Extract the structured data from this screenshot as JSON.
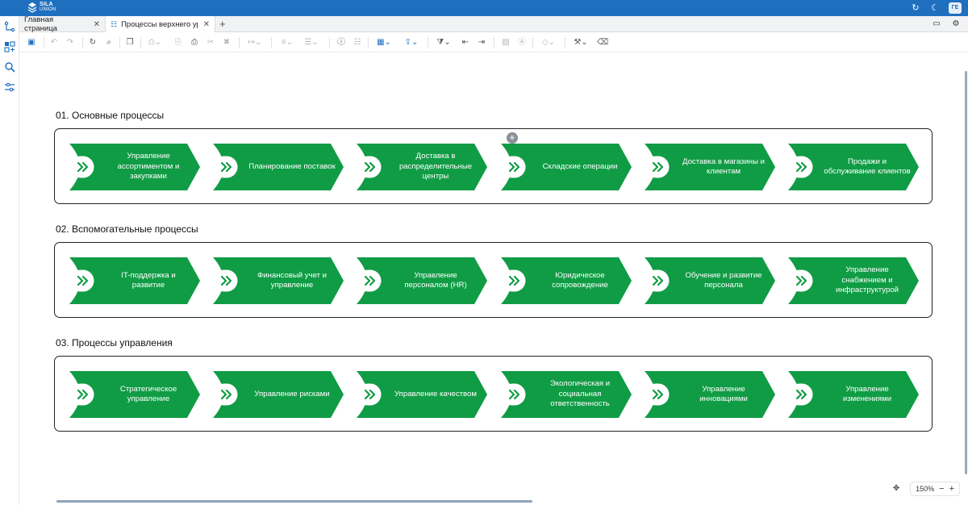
{
  "app": {
    "logo_name": "SILA",
    "logo_sub": "UNION",
    "user_initials": "ГЕ"
  },
  "tabs": [
    {
      "label": "Главная страница"
    },
    {
      "label": "Процессы верхнего ур"
    }
  ],
  "groups": [
    {
      "title": "01. Основные процессы",
      "items": [
        {
          "label": "Управление ассортиментом и закупками"
        },
        {
          "label": "Планирование поставок"
        },
        {
          "label": "Доставка в распределительные центры"
        },
        {
          "label": "Складские операции"
        },
        {
          "label": "Доставка в магазины и клиентам"
        },
        {
          "label": "Продажи и обслуживание клиентов"
        }
      ]
    },
    {
      "title": "02. Вспомогательные процессы",
      "items": [
        {
          "label": "IT-поддержка и развитие"
        },
        {
          "label": "Финансовый учет и управление"
        },
        {
          "label": "Управление персоналом (HR)"
        },
        {
          "label": "Юридическое сопровождение"
        },
        {
          "label": "Обучение и развитие персонала"
        },
        {
          "label": "Управление снабжением и инфраструктурой"
        }
      ]
    },
    {
      "title": "03. Процессы управления",
      "items": [
        {
          "label": "Стратегическое управление"
        },
        {
          "label": "Управление рисками"
        },
        {
          "label": "Управление качеством"
        },
        {
          "label": "Экологическая и социальная ответственность"
        },
        {
          "label": "Управление инновациями"
        },
        {
          "label": "Управление изменениями"
        }
      ]
    }
  ],
  "zoom": {
    "level": "150%"
  },
  "colors": {
    "process_fill": "#109c45",
    "brand_blue": "#1f6fbf",
    "chevron": "#109c45"
  }
}
